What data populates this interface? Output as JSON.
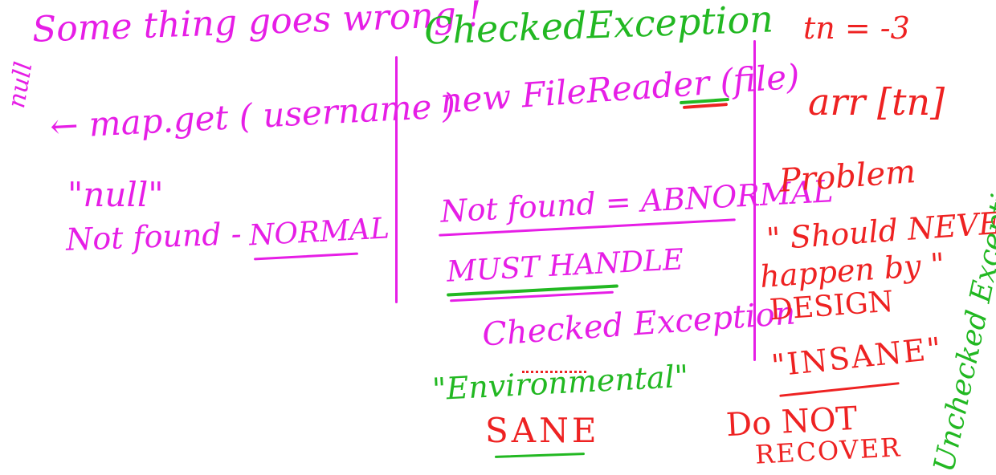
{
  "board": {
    "left": {
      "heading": "Some thing goes wrong !",
      "side_note": "null",
      "expression": "← map.get ( username )",
      "null_quoted": "\"null\"",
      "not_found": "Not found -",
      "normal": "NORMAL"
    },
    "middle": {
      "heading": "CheckedException",
      "file_reader": "new FileReader (file)",
      "not_found_abnormal": "Not found = ABNORMAL",
      "must_handle": "MUST HANDLE",
      "checked_exception": "Checked Exception",
      "environmental": "\"Environmental\"",
      "sane": "SANE"
    },
    "right": {
      "tn": "tn = -3",
      "arr": "arr [tn]",
      "problem": "Problem",
      "should_never": "\" Should NEVER",
      "happen_by": "happen by \"",
      "design": "DESIGN",
      "insane": "\"INSANE\"",
      "do_not": "Do NOT",
      "recover": "RECOVER",
      "unchecked": "Unchecked Exception"
    }
  },
  "colors": {
    "magenta": "#e61ee6",
    "green": "#22b822",
    "red": "#ee2222"
  }
}
